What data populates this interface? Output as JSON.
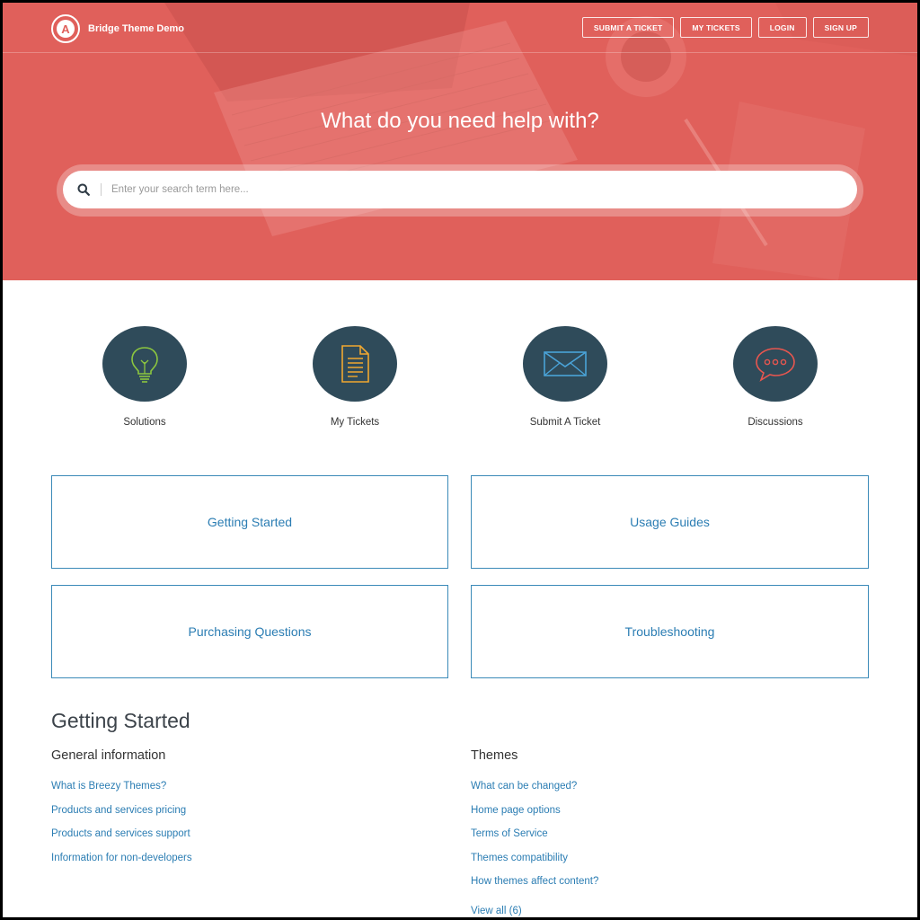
{
  "header": {
    "brand_name": "Bridge Theme Demo",
    "logo_letter": "A",
    "nav": [
      {
        "label": "SUBMIT A TICKET"
      },
      {
        "label": "MY TICKETS"
      },
      {
        "label": "LOGIN"
      },
      {
        "label": "SIGN UP"
      }
    ]
  },
  "hero": {
    "title": "What do you need help with?",
    "search_placeholder": "Enter your search term here...",
    "search_icon": "search-icon",
    "background_color": "#e0605b"
  },
  "features": [
    {
      "label": "Solutions",
      "icon": "lightbulb-icon"
    },
    {
      "label": "My Tickets",
      "icon": "document-icon"
    },
    {
      "label": "Submit A Ticket",
      "icon": "envelope-icon"
    },
    {
      "label": "Discussions",
      "icon": "chat-bubble-icon"
    }
  ],
  "categories": [
    {
      "label": "Getting Started"
    },
    {
      "label": "Usage Guides"
    },
    {
      "label": "Purchasing Questions"
    },
    {
      "label": "Troubleshooting"
    }
  ],
  "articles": {
    "section_title": "Getting Started",
    "columns": [
      {
        "title": "General information",
        "links": [
          "What is Breezy Themes?",
          "Products and services pricing",
          "Products and services support",
          "Information for non-developers"
        ]
      },
      {
        "title": "Themes",
        "links": [
          "What can be changed?",
          "Home page options",
          "Terms of Service",
          "Themes compatibility",
          "How themes affect content?"
        ],
        "view_all": "View all (6)"
      }
    ]
  },
  "colors": {
    "accent": "#e0605b",
    "icon_circle": "#2f4b5a",
    "link": "#2b7db3",
    "card_border": "#3b8ab8"
  }
}
